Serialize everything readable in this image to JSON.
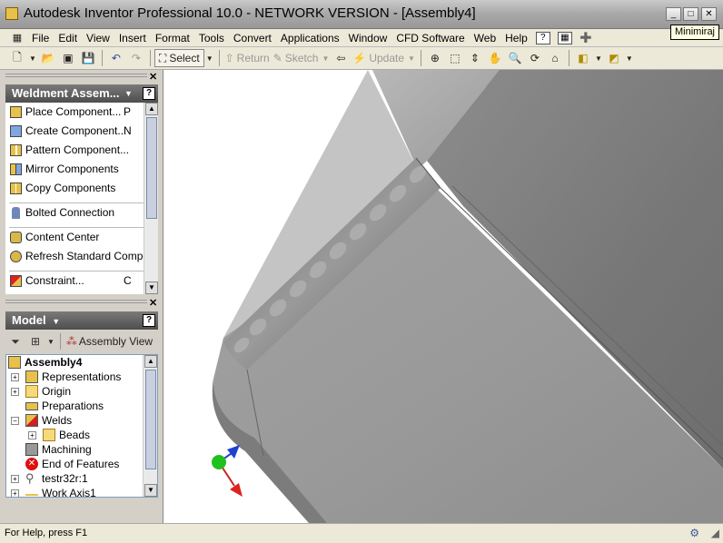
{
  "window": {
    "title": "Autodesk Inventor Professional 10.0 - NETWORK VERSION - [Assembly4]",
    "tooltip": "Minimiraj"
  },
  "menu": [
    "File",
    "Edit",
    "View",
    "Insert",
    "Format",
    "Tools",
    "Convert",
    "Applications",
    "Window",
    "CFD Software",
    "Web",
    "Help"
  ],
  "toolbar": {
    "select_label": "Select",
    "return_label": "Return",
    "sketch_label": "Sketch",
    "update_label": "Update"
  },
  "weldment_panel": {
    "title": "Weldment Assem...",
    "items": [
      {
        "label": "Place Component...",
        "key": "P"
      },
      {
        "label": "Create Component...",
        "key": "N"
      },
      {
        "label": "Pattern Component...",
        "key": ""
      },
      {
        "label": "Mirror Components",
        "key": ""
      },
      {
        "label": "Copy Components",
        "key": ""
      },
      {
        "label": "Bolted Connection",
        "key": ""
      },
      {
        "label": "Content Center",
        "key": ""
      },
      {
        "label": "Refresh Standard Components",
        "key": ""
      },
      {
        "label": "Constraint...",
        "key": "C"
      }
    ]
  },
  "model_panel": {
    "title": "Model",
    "assembly_view_label": "Assembly View",
    "tree": [
      {
        "label": "Assembly4",
        "level": 0,
        "expander": "",
        "bold": true
      },
      {
        "label": "Representations",
        "level": 1,
        "expander": "+"
      },
      {
        "label": "Origin",
        "level": 1,
        "expander": "+"
      },
      {
        "label": "Preparations",
        "level": 1,
        "expander": ""
      },
      {
        "label": "Welds",
        "level": 1,
        "expander": "-"
      },
      {
        "label": "Beads",
        "level": 2,
        "expander": "+"
      },
      {
        "label": "Machining",
        "level": 1,
        "expander": ""
      },
      {
        "label": "End of Features",
        "level": 1,
        "expander": ""
      },
      {
        "label": "testr32r:1",
        "level": 1,
        "expander": "+"
      },
      {
        "label": "Work Axis1",
        "level": 1,
        "expander": "+"
      }
    ]
  },
  "status": {
    "text": "For Help, press F1"
  }
}
